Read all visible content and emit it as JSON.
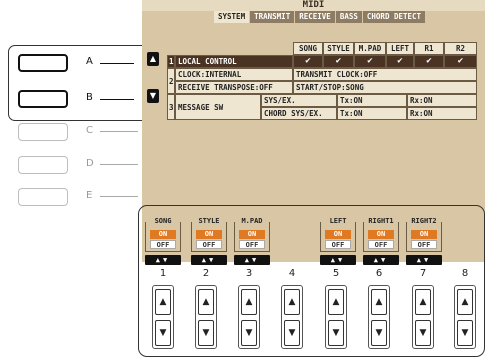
{
  "screen": {
    "title": "MIDI",
    "tabs": [
      "SYSTEM",
      "TRANSMIT",
      "RECEIVE",
      "BASS",
      "CHORD DETECT"
    ],
    "selected_tab": "SYSTEM",
    "columns": [
      "SONG",
      "STYLE",
      "M.PAD",
      "LEFT",
      "R1",
      "R2"
    ],
    "rows": [
      {
        "num": "1",
        "label": "LOCAL CONTROL",
        "checks": [
          "✔",
          "✔",
          "✔",
          "✔",
          "✔",
          "✔"
        ]
      },
      {
        "num": "2",
        "label_a": "CLOCK:INTERNAL",
        "value_a": "TRANSMIT CLOCK:OFF",
        "label_b": "RECEIVE TRANSPOSE:OFF",
        "value_b": "START/STOP:SONG"
      },
      {
        "num": "3",
        "label": "MESSAGE SW",
        "sub": [
          {
            "name": "SYS/EX.",
            "tx": "Tx:ON",
            "rx": "Rx:ON"
          },
          {
            "name": "CHORD SYS/EX.",
            "tx": "Tx:ON",
            "rx": "Rx:ON"
          }
        ]
      }
    ],
    "params": [
      {
        "name": "SONG",
        "on": "ON",
        "off": "OFF"
      },
      {
        "name": "STYLE",
        "on": "ON",
        "off": "OFF"
      },
      {
        "name": "M.PAD",
        "on": "ON",
        "off": "OFF"
      },
      {
        "name": "LEFT",
        "on": "ON",
        "off": "OFF"
      },
      {
        "name": "RIGHT1",
        "on": "ON",
        "off": "OFF"
      },
      {
        "name": "RIGHT2",
        "on": "ON",
        "off": "OFF"
      }
    ]
  },
  "side_buttons": [
    {
      "label": "A",
      "active": true
    },
    {
      "label": "B",
      "active": true
    },
    {
      "label": "C",
      "active": false
    },
    {
      "label": "D",
      "active": false
    },
    {
      "label": "E",
      "active": false
    }
  ],
  "bottom_buttons": {
    "numbers": [
      "1",
      "2",
      "3",
      "4",
      "5",
      "6",
      "7",
      "8"
    ],
    "up_glyph": "▲",
    "down_glyph": "▼"
  },
  "icons": {
    "up": "triangle-up-icon",
    "down": "triangle-down-icon",
    "check": "checkmark-icon"
  },
  "colors": {
    "lcd_bg": "#d8c6a4",
    "on_orange": "#e07a22",
    "row_dark": "#4a3322"
  }
}
